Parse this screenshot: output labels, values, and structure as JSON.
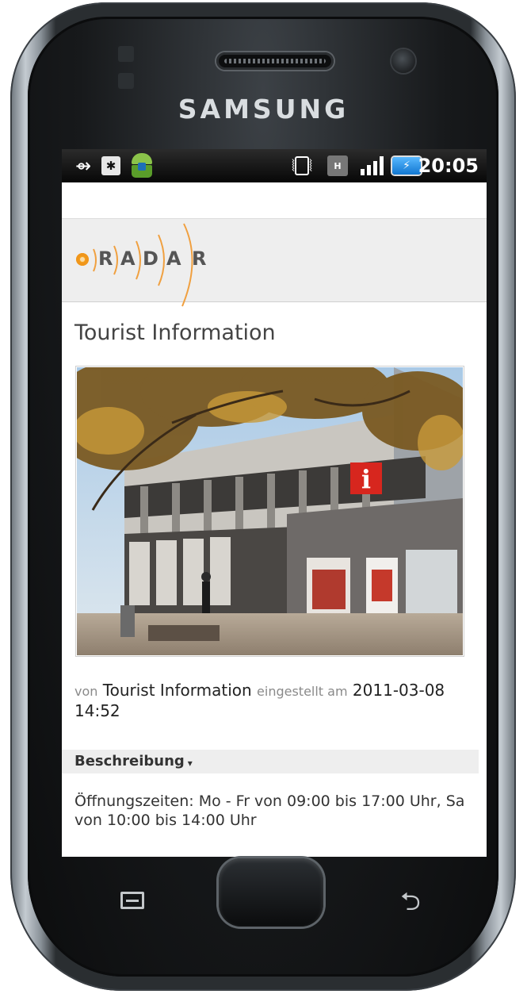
{
  "device": {
    "brand": "SAMSUNG"
  },
  "statusbar": {
    "time": "20:05",
    "icons": [
      "usb-icon",
      "usb-debugging-icon",
      "android-notification-icon",
      "vibrate-icon",
      "hspa-data-icon",
      "signal-icon",
      "battery-charging-icon"
    ],
    "hspa_label": "H",
    "battery_symbol": "⚡"
  },
  "header": {
    "logo_letters": [
      "R",
      "A",
      "D",
      "A",
      "R"
    ],
    "logo_colors": {
      "dot": "#f5a623",
      "arcs": "#f0a040",
      "letters": "#555555"
    }
  },
  "main": {
    "title": "Tourist Information",
    "photo_alt": "Tourist Information building",
    "meta": {
      "by_label": "von",
      "author": "Tourist Information",
      "posted_label": "eingestellt am",
      "datetime": "2011-03-08 14:52"
    },
    "section": {
      "label": "Beschreibung",
      "caret": "▾"
    },
    "description": "Öffnungszeiten: Mo - Fr von 09:00 bis 17:00 Uhr, Sa von 10:00 bis 14:00 Uhr"
  },
  "keys": {
    "menu": "menu-icon",
    "home": "home-button",
    "back": "back-icon",
    "back_glyph": "⮌"
  }
}
